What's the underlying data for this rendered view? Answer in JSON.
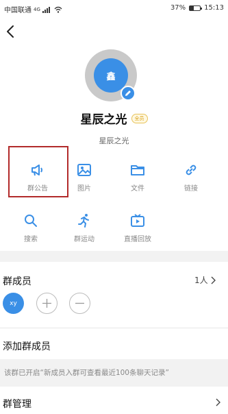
{
  "status_bar": {
    "carrier": "中国联通",
    "network": "4G",
    "battery": "37%",
    "battery_level": 0.37,
    "time": "15:13"
  },
  "nav": {
    "back_icon": "back-chevron-icon"
  },
  "profile": {
    "avatar_text": "鑫",
    "name": "星辰之光",
    "badge": "全员",
    "subtitle": "星辰之光",
    "edit_icon": "pencil-icon"
  },
  "actions": [
    {
      "label": "群公告",
      "icon": "megaphone-icon"
    },
    {
      "label": "图片",
      "icon": "image-icon"
    },
    {
      "label": "文件",
      "icon": "folder-icon"
    },
    {
      "label": "链接",
      "icon": "link-icon"
    },
    {
      "label": "搜索",
      "icon": "search-icon"
    },
    {
      "label": "群运动",
      "icon": "running-icon"
    },
    {
      "label": "直播回放",
      "icon": "tv-icon"
    }
  ],
  "members": {
    "title": "群成员",
    "count": "1人",
    "member_avatar_text": "xy"
  },
  "add_member": {
    "label": "添加群成员"
  },
  "notice": {
    "text": "该群已开启“新成员入群可查看最近100条聊天记录”"
  },
  "manage": {
    "label": "群管理"
  },
  "colors": {
    "accent": "#3a8fe6",
    "highlight": "#b22a2a",
    "badge": "#d9a21b"
  }
}
